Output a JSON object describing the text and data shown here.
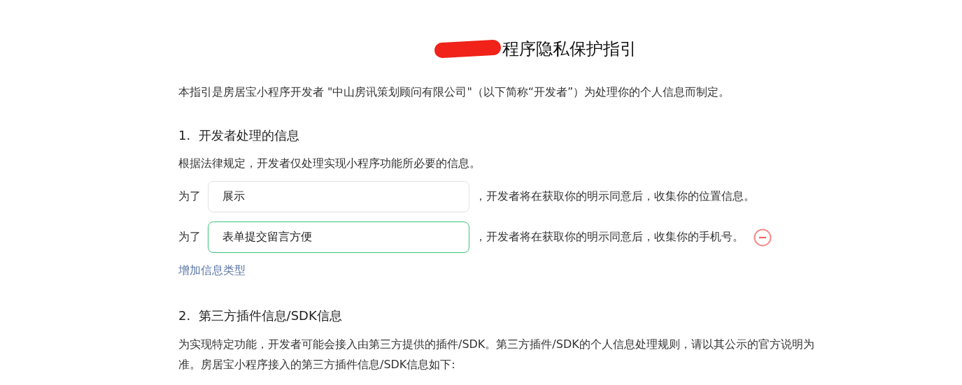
{
  "title": {
    "visible_text": "程序隐私保护指引",
    "redacted": true
  },
  "intro": "本指引是房居宝小程序开发者 \"中山房讯策划顾问有限公司\"（以下简称“开发者”）为处理你的个人信息而制定。",
  "section_1": {
    "heading": "1.  开发者处理的信息",
    "description": "根据法律规定，开发者仅处理实现小程序功能所必要的信息。",
    "items": [
      {
        "prefix": "为了",
        "value": "展示",
        "focused": false,
        "suffix": "，开发者将在获取你的明示同意后，收集你的位置信息。",
        "removable": false
      },
      {
        "prefix": "为了",
        "value": "表单提交留言方便",
        "focused": true,
        "suffix": "，开发者将在获取你的明示同意后，收集你的手机号。",
        "removable": true
      }
    ],
    "add_link": "增加信息类型"
  },
  "section_2": {
    "heading": "2.  第三方插件信息/SDK信息",
    "description": "为实现特定功能，开发者可能会接入由第三方提供的插件/SDK。第三方插件/SDK的个人信息处理规则，请以其公示的官方说明为准。房居宝小程序接入的第三方插件信息/SDK信息如下:"
  }
}
